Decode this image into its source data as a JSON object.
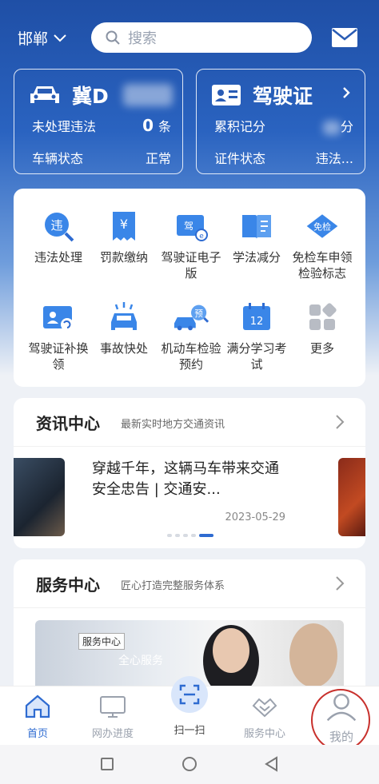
{
  "colors": {
    "primary": "#2e6bd1",
    "hero_top": "#1f4fa6",
    "highlight_ring": "#c8302c"
  },
  "topbar": {
    "city": "邯郸",
    "search_placeholder": "搜索"
  },
  "vehicle_card": {
    "plate_prefix": "冀D",
    "violation_label": "未处理违法",
    "violation_count": "0",
    "violation_unit": "条",
    "status_label": "车辆状态",
    "status_value": "正常"
  },
  "license_card": {
    "title": "驾驶证",
    "points_label": "累积记分",
    "points_unit": "分",
    "status_label": "证件状态",
    "status_value": "违法..."
  },
  "services": [
    {
      "label": "违法处理",
      "icon": "violation-search-icon"
    },
    {
      "label": "罚款缴纳",
      "icon": "fine-receipt-icon"
    },
    {
      "label": "驾驶证电子版",
      "icon": "e-license-icon"
    },
    {
      "label": "学法减分",
      "icon": "book-icon"
    },
    {
      "label": "免检车申领检验标志",
      "icon": "exempt-badge-icon"
    },
    {
      "label": "驾驶证补换领",
      "icon": "license-renew-icon"
    },
    {
      "label": "事故快处",
      "icon": "accident-icon"
    },
    {
      "label": "机动车检验预约",
      "icon": "inspection-booking-icon"
    },
    {
      "label": "满分学习考试",
      "icon": "calendar-exam-icon"
    },
    {
      "label": "更多",
      "icon": "more-grid-icon"
    }
  ],
  "news": {
    "title": "资讯中心",
    "subtitle": "最新实时地方交通资讯",
    "headline": "穿越千年，这辆马车带来交通安全忠告 | 交通安...",
    "date": "2023-05-29"
  },
  "service_center": {
    "title": "服务中心",
    "subtitle": "匠心打造完整服务体系",
    "banner_tag": "服务中心",
    "banner_text": "全心服务"
  },
  "tabs": [
    {
      "label": "首页",
      "icon": "home-icon",
      "active": true
    },
    {
      "label": "网办进度",
      "icon": "monitor-icon",
      "active": false
    },
    {
      "label": "扫一扫",
      "icon": "scan-icon",
      "active": false
    },
    {
      "label": "服务中心",
      "icon": "handshake-icon",
      "active": false
    },
    {
      "label": "我的",
      "icon": "user-icon",
      "active": false
    }
  ]
}
